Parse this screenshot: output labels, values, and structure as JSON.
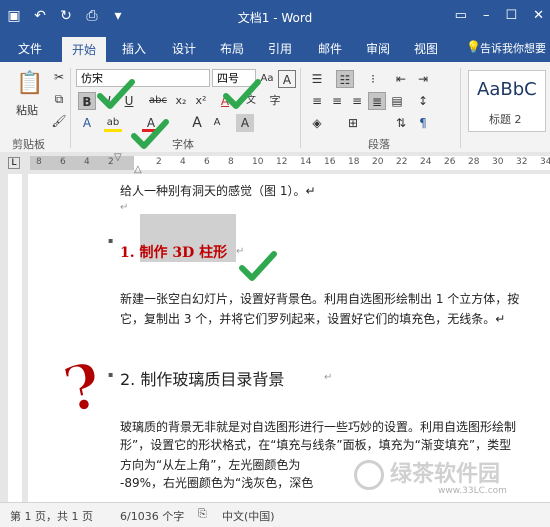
{
  "window": {
    "title": "文档1 - Word",
    "controls": [
      "▭",
      "–",
      "☐",
      "✕"
    ]
  },
  "qat": [
    "save-icon",
    "undo-icon",
    "redo-icon",
    "print-preview-icon",
    "customize-icon"
  ],
  "tabs": [
    "文件",
    "开始",
    "插入",
    "设计",
    "布局",
    "引用",
    "邮件",
    "审阅",
    "视图"
  ],
  "tell_me": "告诉我你想要",
  "ribbon": {
    "clipboard": {
      "paste": "粘贴",
      "label": "剪贴板"
    },
    "font": {
      "name": "仿宋",
      "size": "四号",
      "label": "字体",
      "bold": "B",
      "italic": "I",
      "underline": "U",
      "strike": "abc",
      "sub": "x₂",
      "sup": "x²",
      "grow": "A",
      "shrink": "A",
      "aa": "Aa",
      "clear": "A",
      "phonetic": "文",
      "border": "A",
      "effects": "A",
      "highlight": "ab",
      "color": "A",
      "char_shading": "A",
      "enclose": "字"
    },
    "paragraph": {
      "label": "段落"
    },
    "styles": {
      "sample": "AaBbC",
      "name": "标题 2"
    }
  },
  "ruler_ticks": [
    "8",
    "6",
    "4",
    "2",
    "",
    "2",
    "4",
    "6",
    "8",
    "10",
    "12",
    "14",
    "16",
    "18",
    "20",
    "22",
    "24",
    "26",
    "28",
    "30",
    "32",
    "34",
    "36"
  ],
  "doc": {
    "line1": "给人一种别有洞天的感觉（图 1）。↵",
    "empty1": "↵",
    "heading1": "1.  制作 3D 柱形",
    "heading1_mark": "↵",
    "para1a": "新建一张空白幻灯片，设置好背景色。利用自选图形绘制出 1 个立方体，按",
    "para1b": "它，复制出 3 个，并将它们罗列起来，设置好它们的填充色，无线条。↵",
    "heading2": "2.  制作玻璃质目录背景",
    "heading2_mark": "↵",
    "para2a": "玻璃质的背景无非就是对自选图形进行一些巧妙的设置。利用自选图形绘制",
    "para2b": "形”，设置它的形状格式，在“填充与线条”面板，填充为“渐变填充”，类型",
    "para2c": "方向为“从左上角”，左光圈颜色为",
    "para2d": "-89%，右光圈颜色为“浅灰色，深色"
  },
  "status": {
    "page": "第 1 页，共 1 页",
    "words": "6/1036 个字",
    "lang": "中文(中国)"
  },
  "watermark": {
    "text": "绿茶软件园",
    "url": "www.33LC.com"
  },
  "colors": {
    "accent": "#2b579a",
    "check": "#2fa84f",
    "heading_red": "#c00000",
    "question": "#b00000"
  }
}
